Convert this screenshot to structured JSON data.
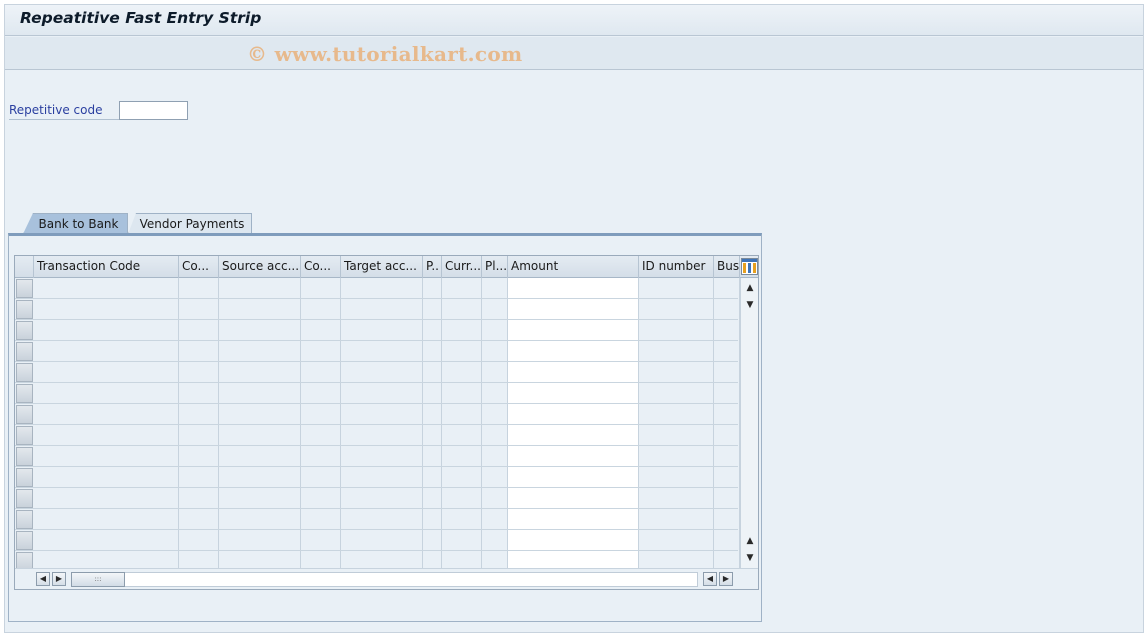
{
  "window": {
    "title": "Repeatitive Fast Entry Strip",
    "watermark": "© www.tutorialkart.com"
  },
  "form": {
    "repetitive_code_label": "Repetitive code",
    "repetitive_code_value": ""
  },
  "tabs": [
    {
      "label": "Bank to Bank",
      "selected": true
    },
    {
      "label": "Vendor Payments",
      "selected": false
    }
  ],
  "table": {
    "columns": [
      "Transaction Code",
      "Co...",
      "Source acc...",
      "Co...",
      "Target acc...",
      "P..",
      "Curr...",
      "Pl...",
      "Amount",
      "ID number",
      "Busi"
    ],
    "row_count": 14
  },
  "icons": {
    "settings": "table-settings-icon",
    "scroll_up": "▲",
    "scroll_down": "▼",
    "scroll_left": "◀",
    "scroll_right": "▶",
    "thumb_grip": ":::"
  },
  "colors": {
    "background": "#e9f0f6",
    "amount_column": "#ffffff",
    "selected_tab": "#a8c1dc",
    "label_blue": "#2a3fa0"
  }
}
